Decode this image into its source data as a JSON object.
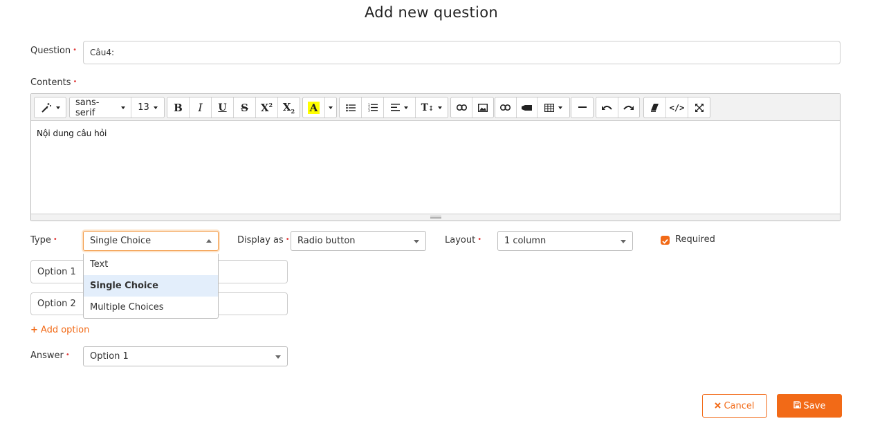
{
  "page": {
    "title": "Add new question"
  },
  "question": {
    "label": "Question",
    "value": "Câu4:"
  },
  "contents": {
    "label": "Contents",
    "body_text": "Nội dung câu hỏi",
    "toolbar": {
      "font_family": "sans-serif",
      "font_size": "13",
      "icons": [
        "magic-wand-icon",
        "bold-icon",
        "italic-icon",
        "underline-icon",
        "strikethrough-icon",
        "superscript-icon",
        "subscript-icon",
        "highlight-color-icon",
        "unordered-list-icon",
        "ordered-list-icon",
        "align-icon",
        "line-height-icon",
        "link-icon",
        "picture-icon",
        "video-link-icon",
        "video-icon",
        "table-icon",
        "horizontal-rule-icon",
        "undo-icon",
        "redo-icon",
        "eraser-icon",
        "code-view-icon",
        "fullscreen-icon"
      ]
    }
  },
  "type": {
    "label": "Type",
    "value": "Single Choice",
    "options": [
      "Text",
      "Single Choice",
      "Multiple Choices"
    ]
  },
  "display_as": {
    "label": "Display as",
    "value": "Radio button"
  },
  "layout": {
    "label": "Layout",
    "value": "1 column"
  },
  "required": {
    "label": "Required",
    "checked": true
  },
  "options": [
    {
      "value": "Option 1"
    },
    {
      "value": "Option 2"
    }
  ],
  "add_option": {
    "label": "Add option"
  },
  "answer": {
    "label": "Answer",
    "value": "Option 1"
  },
  "actions": {
    "cancel_label": "Cancel",
    "save_label": "Save"
  },
  "colors": {
    "accent": "#f26a17",
    "required_mark": "#e03b3b",
    "selected_item_bg": "#e3eefb",
    "highlight_yellow": "#ffff00"
  }
}
